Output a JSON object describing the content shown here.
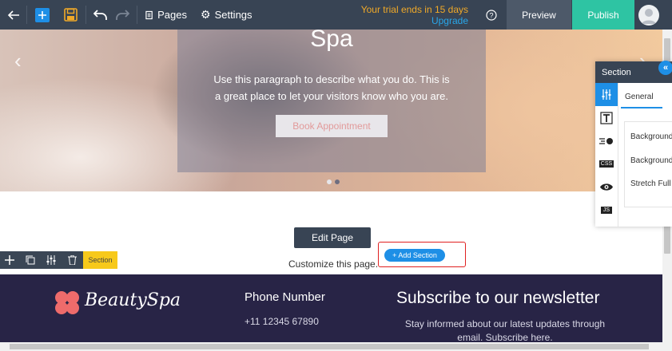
{
  "topbar": {
    "pages_label": "Pages",
    "settings_label": "Settings",
    "trial_text": "Your trial ends in 15 days",
    "upgrade_label": "Upgrade",
    "preview_label": "Preview",
    "publish_label": "Publish"
  },
  "hero": {
    "title": "Spa",
    "paragraph": "Use this paragraph to describe what you do. This is a great place to let your visitors know who you are.",
    "button_label": "Book Appointment"
  },
  "editor": {
    "edit_page_label": "Edit Page",
    "customize_text": "Customize this page.",
    "add_section_label": "+ Add Section",
    "section_tag": "Section"
  },
  "footer": {
    "brand": "BeautySpa",
    "phone_heading": "Phone Number",
    "phone_value": "+11 12345 67890",
    "newsletter_heading": "Subscribe to our newsletter",
    "newsletter_text": "Stay informed about our latest updates through email. Subscribe here."
  },
  "panel": {
    "title": "Section",
    "tab_general": "General",
    "items": [
      "Background",
      "Background",
      "Stretch Full"
    ],
    "side_tabs": [
      "settings",
      "text",
      "animation",
      "CSS",
      "visibility",
      "JS"
    ]
  },
  "colors": {
    "topbar": "#384454",
    "accent_blue": "#1e8fe6",
    "publish": "#2ec4a3",
    "trial": "#f0a928",
    "section_tag": "#f7c91a",
    "footer": "#282446",
    "logo_pink": "#ee6b6b"
  }
}
